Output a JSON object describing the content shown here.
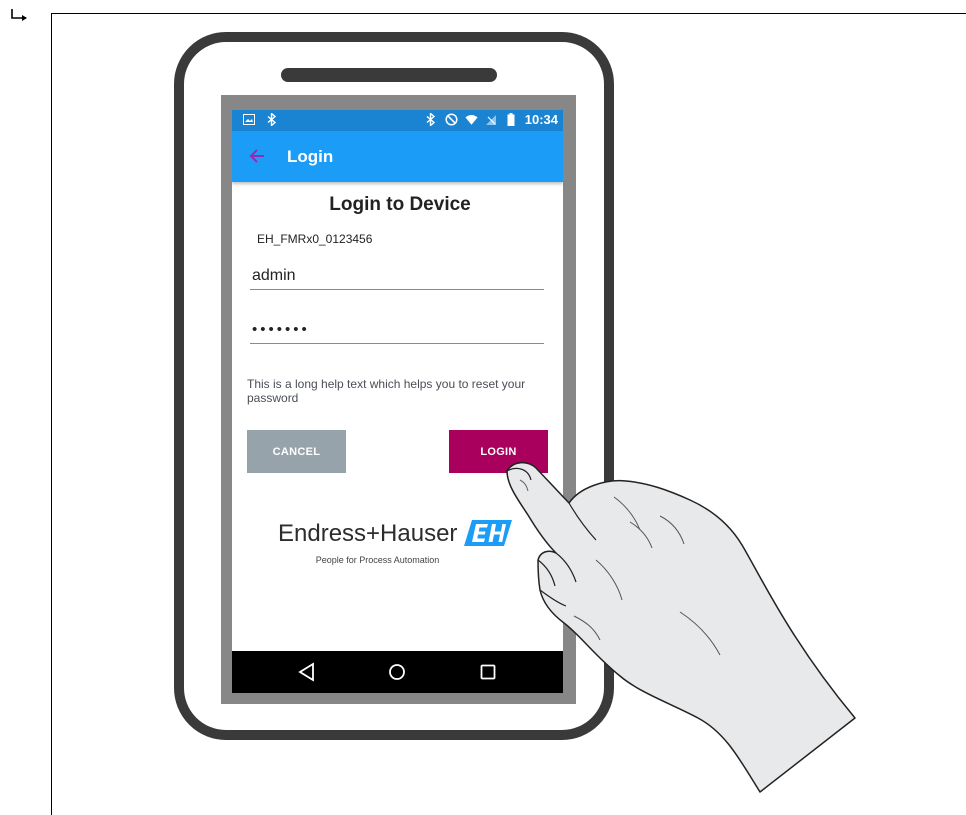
{
  "status_bar": {
    "time": "10:34",
    "left_icons": [
      "image-icon",
      "bluetooth-icon"
    ],
    "right_icons": [
      "bluetooth-icon",
      "do-not-disturb-icon",
      "wifi-icon",
      "no-signal-icon",
      "battery-icon"
    ]
  },
  "app_bar": {
    "title": "Login",
    "back_icon": "arrow-left-icon",
    "back_icon_color": "#9c27b0"
  },
  "login_form": {
    "heading": "Login to Device",
    "device_id": "EH_FMRx0_0123456",
    "username_value": "admin",
    "password_value": "•••••••",
    "help_text": "This is a long help text which helps you to reset your password",
    "cancel_label": "CANCEL",
    "login_label": "LOGIN"
  },
  "branding": {
    "name": "Endress+Hauser",
    "tagline": "People for Process Automation",
    "logo_text": "EH",
    "logo_color": "#1b9cf7"
  },
  "nav_bar": {
    "icons": [
      "nav-back-icon",
      "nav-home-icon",
      "nav-recent-icon"
    ]
  },
  "colors": {
    "status_bar": "#1a83d2",
    "app_bar": "#1b9cf7",
    "cancel_button": "#97a3ab",
    "login_button": "#a8005c",
    "phone_frame": "#3a3a3a"
  }
}
